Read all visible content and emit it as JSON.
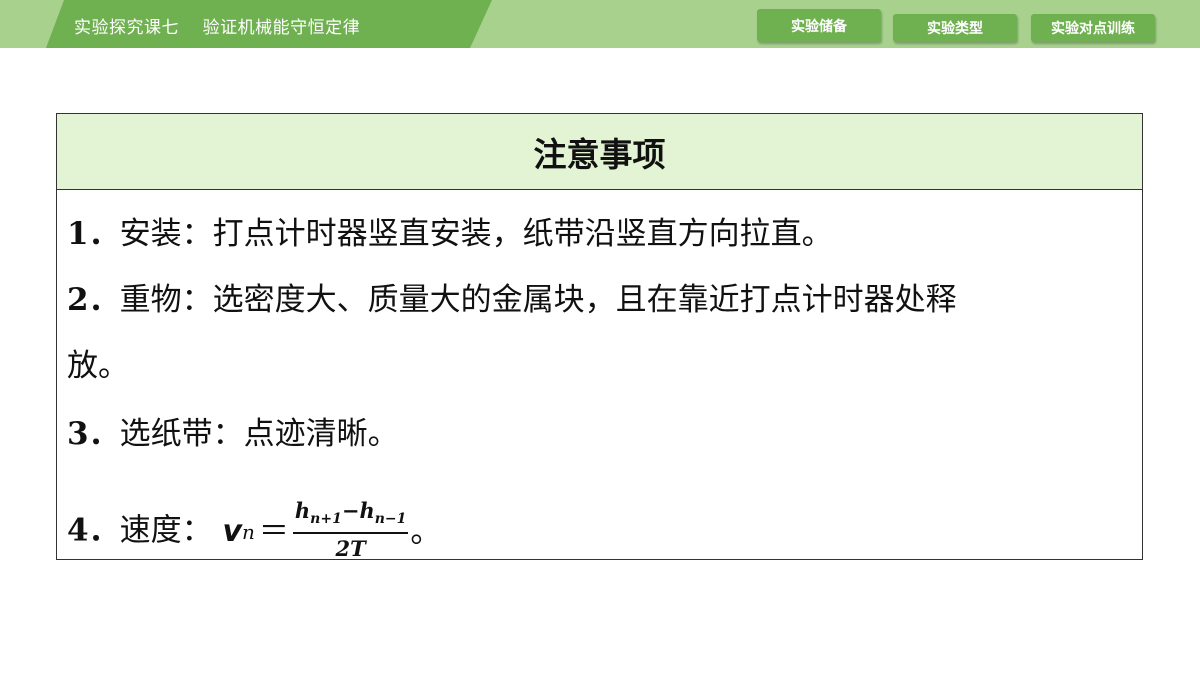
{
  "header": {
    "title": "实验探究课七    验证机械能守恒定律",
    "nav": [
      "实验储备",
      "实验类型",
      "实验对点训练"
    ]
  },
  "panel": {
    "title": "注意事项",
    "items": [
      {
        "num": "1．",
        "text": "安装：打点计时器竖直安装，纸带沿竖直方向拉直。"
      },
      {
        "num": "2．",
        "text": "重物：选密度大、质量大的金属块，且在靠近打点计时器处释",
        "cont": "放。"
      },
      {
        "num": "3．",
        "text": "选纸带：点迹清晰。"
      },
      {
        "num": "4．",
        "text": "速度："
      }
    ],
    "formula": {
      "var": "v",
      "sub": "n",
      "eq": "＝",
      "numerator": "h",
      "numerator_sub1": "n+1",
      "minus": "−",
      "numerator2": "h",
      "numerator_sub2": "n−1",
      "denominator": "2T",
      "tail": "。"
    }
  },
  "colors": {
    "band": "#a9d18e",
    "tab": "#6fb050",
    "panel_head": "#e2f4d3"
  }
}
